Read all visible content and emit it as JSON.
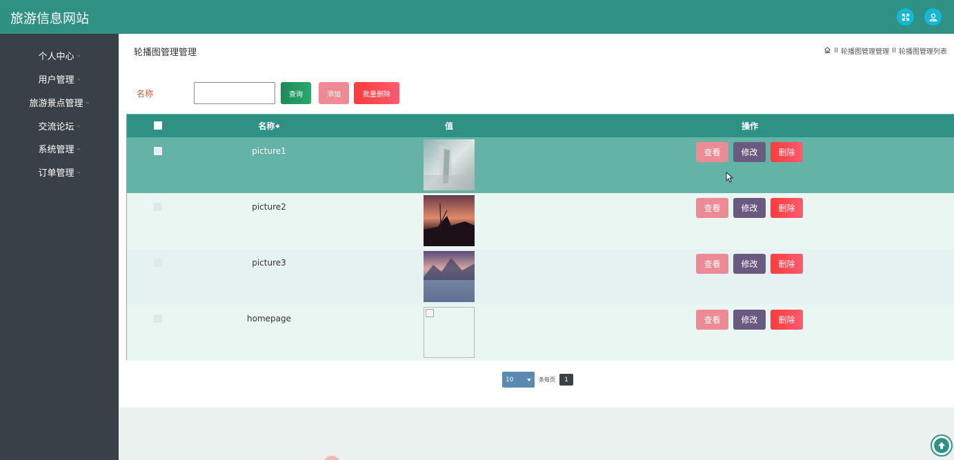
{
  "app": {
    "title": "旅游信息网站"
  },
  "header": {
    "icons": [
      "fullscreen-icon",
      "user-icon"
    ],
    "color": "#2f9183"
  },
  "sidebar": {
    "items": [
      {
        "label": "个人中心"
      },
      {
        "label": "用户管理"
      },
      {
        "label": "旅游景点管理"
      },
      {
        "label": "交流论坛"
      },
      {
        "label": "系统管理"
      },
      {
        "label": "订单管理"
      }
    ]
  },
  "page": {
    "title": "轮播图管理管理",
    "breadcrumb": {
      "separator": "II",
      "item1": "轮播图管理管理",
      "item2": "轮播图管理列表"
    }
  },
  "search": {
    "label": "名称",
    "value": "",
    "query_button": "查询",
    "add_button": "添加",
    "batch_delete_button": "批量删除"
  },
  "table": {
    "headers": {
      "name": "名称",
      "value": "值",
      "actions": "操作"
    },
    "rows": [
      {
        "name": "picture1",
        "image": "photo",
        "selected": true
      },
      {
        "name": "picture2",
        "image": "photo",
        "selected": false
      },
      {
        "name": "picture3",
        "image": "photo",
        "selected": false
      },
      {
        "name": "homepage",
        "image": "broken",
        "selected": false
      }
    ],
    "row_actions": {
      "view": "查看",
      "edit": "修改",
      "delete": "删除"
    }
  },
  "pagination": {
    "page_size": "10",
    "per_page_label": "条每页",
    "current_page": "1"
  },
  "colors": {
    "accent": "#2f9183",
    "sidebar": "#394146",
    "view_button": "#ee8a93",
    "edit_button": "#6a5a80",
    "delete_button": "#ff4a5c"
  }
}
